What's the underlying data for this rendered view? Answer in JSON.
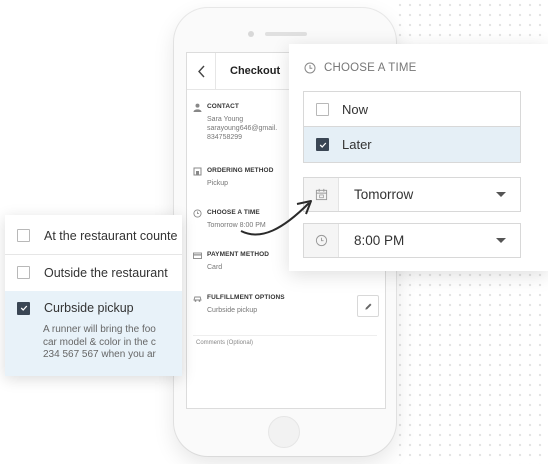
{
  "phone": {
    "header": {
      "title": "Checkout"
    },
    "sections": {
      "contact": {
        "title": "CONTACT",
        "lines": [
          "Sara Young",
          "sarayoung646@gmail.",
          "834758299"
        ]
      },
      "ordering": {
        "title": "ORDERING METHOD",
        "value": "Pickup"
      },
      "time": {
        "title": "CHOOSE A TIME",
        "value": "Tomorrow 8:00 PM"
      },
      "payment": {
        "title": "PAYMENT METHOD",
        "value": "Card"
      },
      "fulfillment": {
        "title": "FULFILLMENT OPTIONS",
        "value": "Curbside pickup"
      }
    },
    "comments_label": "Comments (Optional)"
  },
  "fulfillment_card": {
    "options": [
      {
        "label": "At the restaurant counte",
        "checked": false
      },
      {
        "label": "Outside the restaurant",
        "checked": false
      },
      {
        "label": "Curbside pickup",
        "checked": true
      }
    ],
    "description_lines": [
      "A runner will bring the foo",
      "car model & color in the c",
      "234 567 567 when you ar"
    ]
  },
  "time_card": {
    "title": "CHOOSE A TIME",
    "options": [
      {
        "label": "Now",
        "checked": false
      },
      {
        "label": "Later",
        "checked": true
      }
    ],
    "day_select": {
      "value": "Tomorrow",
      "icon": "calendar-icon"
    },
    "time_select": {
      "value": "8:00 PM",
      "icon": "clock-icon"
    }
  },
  "colors": {
    "selected_bg": "#e5eff6",
    "checkbox_checked": "#3a4654",
    "accent_text": "#777777"
  }
}
